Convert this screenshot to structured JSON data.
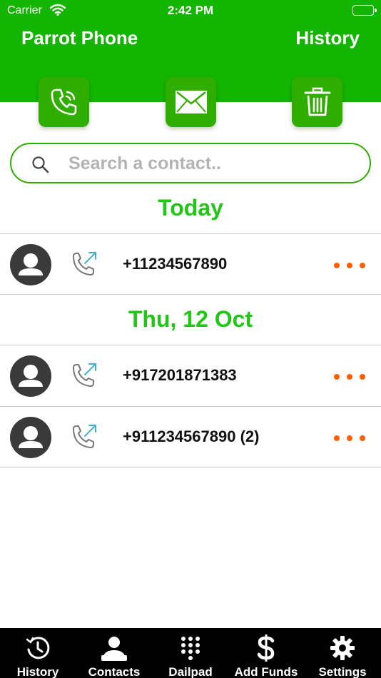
{
  "status_bar": {
    "carrier": "Carrier",
    "time": "2:42 PM"
  },
  "header": {
    "app_title": "Parrot Phone",
    "page_label": "History"
  },
  "actions": [
    {
      "id": "call",
      "icon": "phone-icon"
    },
    {
      "id": "message",
      "icon": "envelope-icon"
    },
    {
      "id": "delete",
      "icon": "trash-icon"
    }
  ],
  "search": {
    "placeholder": "Search a contact..",
    "value": ""
  },
  "sections": [
    {
      "title": "Today",
      "entries": [
        {
          "number": "+11234567890",
          "direction": "outgoing"
        }
      ]
    },
    {
      "title": "Thu, 12 Oct",
      "entries": [
        {
          "number": "+917201871383",
          "direction": "outgoing"
        },
        {
          "number": "+911234567890 (2)",
          "direction": "outgoing"
        }
      ]
    }
  ],
  "tabs": [
    {
      "label": "History",
      "icon": "history-clock-icon"
    },
    {
      "label": "Contacts",
      "icon": "contacts-person-icon"
    },
    {
      "label": "Dailpad",
      "icon": "dialpad-icon"
    },
    {
      "label": "Add Funds",
      "icon": "dollar-icon"
    },
    {
      "label": "Settings",
      "icon": "gear-icon"
    }
  ],
  "colors": {
    "header_green": "#13b500",
    "button_green": "#2fae00",
    "section_green": "#22c716",
    "more_orange": "#ff5f00",
    "tabbar_bg": "#000000"
  }
}
